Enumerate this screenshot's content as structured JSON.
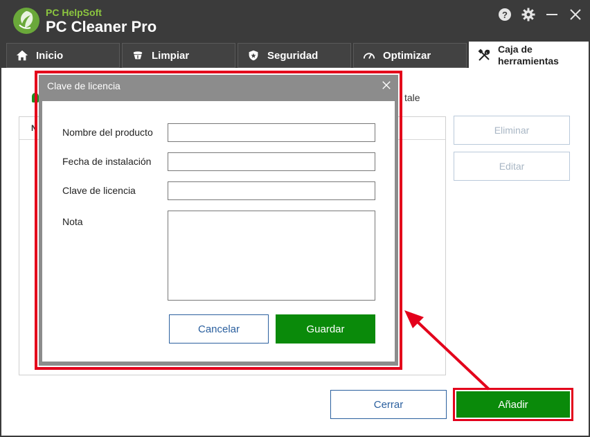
{
  "app": {
    "brand_company": "PC HelpSoft",
    "brand_product": "PC Cleaner Pro"
  },
  "window_controls": [
    "help-icon",
    "gear-icon",
    "minimize-icon",
    "close-icon"
  ],
  "tabs": [
    {
      "label": "Inicio",
      "icon": "home-icon"
    },
    {
      "label": "Limpiar",
      "icon": "broom-icon"
    },
    {
      "label": "Seguridad",
      "icon": "shield-icon"
    },
    {
      "label": "Optimizar",
      "icon": "speedometer-icon"
    },
    {
      "label": "Caja de herramientas",
      "icon": "tools-icon",
      "active": true
    }
  ],
  "background": {
    "partial_text": "tale",
    "list_column_partial": "N",
    "side_buttons": {
      "delete": "Eliminar",
      "edit": "Editar"
    },
    "close_button": "Cerrar",
    "add_button": "Añadir"
  },
  "dialog": {
    "title": "Clave de licencia",
    "fields": {
      "product_name": {
        "label": "Nombre del producto",
        "value": ""
      },
      "install_date": {
        "label": "Fecha de instalación",
        "value": ""
      },
      "license_key": {
        "label": "Clave de licencia",
        "value": ""
      },
      "note": {
        "label": "Nota",
        "value": ""
      }
    },
    "cancel_button": "Cancelar",
    "save_button": "Guardar"
  },
  "colors": {
    "accent_green": "#0a8a0a",
    "highlight_red": "#e3001b",
    "link_blue": "#2a5f9e",
    "titlebar": "#3b3b3b",
    "brand_green": "#8cc63f"
  }
}
